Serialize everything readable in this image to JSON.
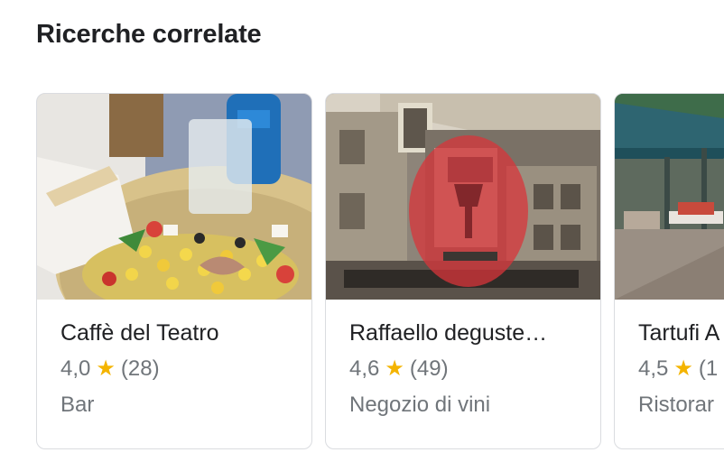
{
  "section": {
    "title": "Ricerche correlate"
  },
  "cards": [
    {
      "name": "Caffè del Teatro",
      "rating": "4,0",
      "reviews": "(28)",
      "category": "Bar",
      "icon": "star-icon"
    },
    {
      "name": "Raffaello deguste…",
      "rating": "4,6",
      "reviews": "(49)",
      "category": "Negozio di vini",
      "icon": "star-icon"
    },
    {
      "name": "Tartufi A",
      "rating": "4,5",
      "reviews": "(1",
      "category": "Ristorar",
      "icon": "star-icon"
    }
  ],
  "colors": {
    "title": "#202124",
    "secondary": "#70757a",
    "star": "#f4b400",
    "border": "#dadce0"
  }
}
